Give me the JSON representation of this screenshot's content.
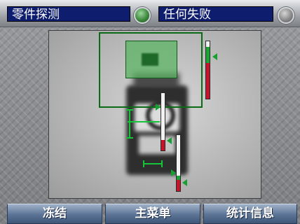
{
  "header": {
    "tool_name": "零件探测",
    "tool_status_icon": "green-led-icon",
    "condition": "任何失败",
    "condition_status_icon": "gray-led-icon"
  },
  "gauges": [
    {
      "name": "top-gauge",
      "green_fraction": 0.28,
      "red_fraction": 0.62
    },
    {
      "name": "middle-gauge",
      "green_fraction": 0.0,
      "red_fraction": 0.18
    },
    {
      "name": "bottom-gauge",
      "green_fraction": 0.08,
      "red_fraction": 0.2
    }
  ],
  "buttons": {
    "freeze": "冻结",
    "main_menu": "主菜单",
    "statistics": "统计信息"
  },
  "colors": {
    "title_field": "#0f1d6e",
    "overlay_green": "#16a030",
    "fail_red": "#c8142a",
    "button_blue": "#5b7395"
  }
}
